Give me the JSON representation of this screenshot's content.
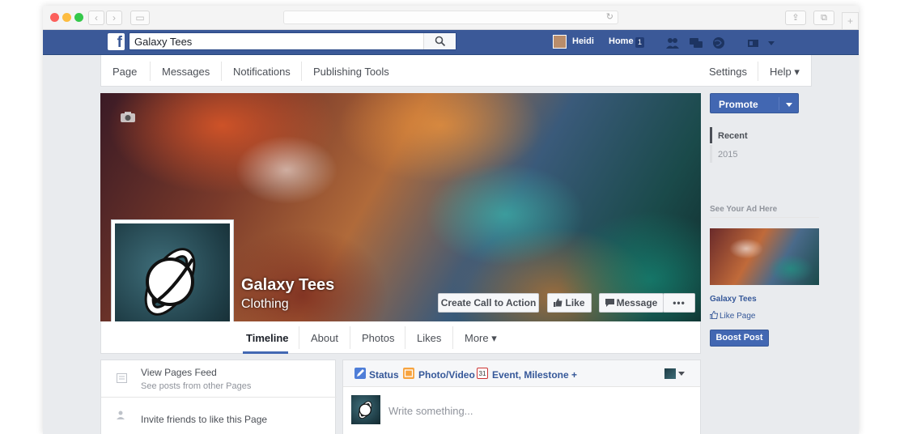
{
  "fbbar": {
    "search_value": "Galaxy Tees",
    "user_name": "Heidi",
    "home_label": "Home",
    "home_badge": "1"
  },
  "page_menu": {
    "items": [
      "Page",
      "Messages",
      "Notifications",
      "Publishing Tools"
    ],
    "settings": "Settings",
    "help": "Help ▾"
  },
  "cover": {
    "page_name": "Galaxy Tees",
    "category": "Clothing",
    "cta_label": "Create Call to Action",
    "like_label": "Like",
    "message_label": "Message",
    "more_label": "•••"
  },
  "tabs": {
    "items": [
      "Timeline",
      "About",
      "Photos",
      "Likes",
      "More ▾"
    ],
    "active": "Timeline"
  },
  "left_panel": {
    "feed_title": "View Pages Feed",
    "feed_sub": "See posts from other Pages",
    "invite": "Invite friends to like this Page"
  },
  "composer": {
    "status": "Status",
    "photo": "Photo/Video",
    "event": "Event, Milestone +",
    "calendar_num": "31",
    "placeholder": "Write something..."
  },
  "right": {
    "promote": "Promote",
    "years": [
      "Recent",
      "2015"
    ],
    "ad_title": "See Your Ad Here",
    "ad_name": "Galaxy Tees",
    "ad_like": "Like Page",
    "boost": "Boost Post"
  },
  "colors": {
    "fb_blue": "#3b5998",
    "button_blue": "#4267b2",
    "link_blue": "#365899"
  }
}
